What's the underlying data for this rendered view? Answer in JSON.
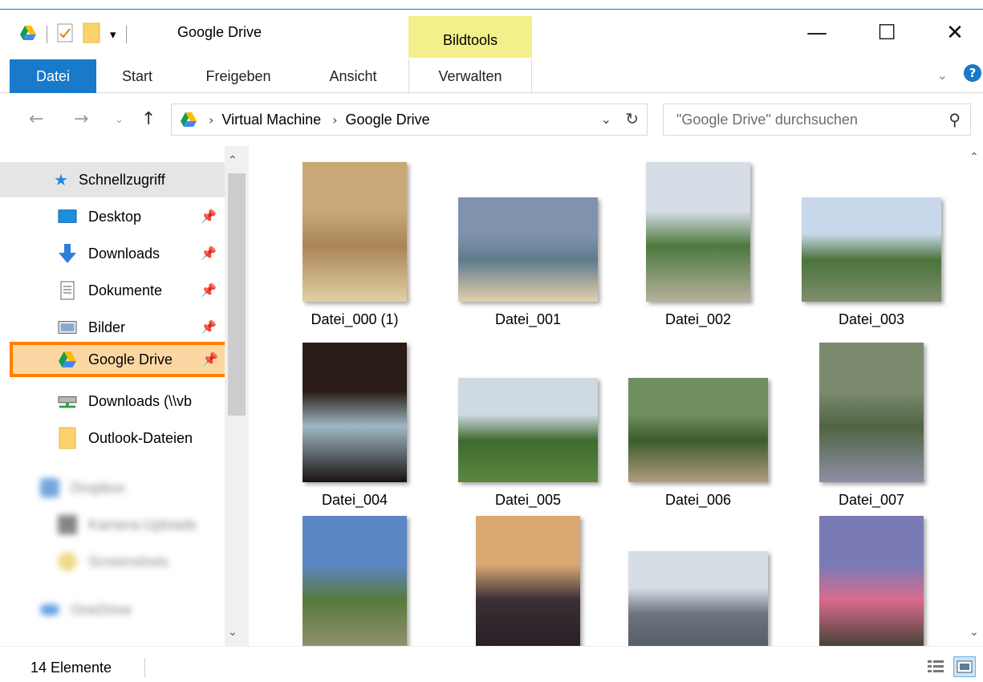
{
  "window": {
    "title": "Google Drive",
    "contextual_tab_group": "Bildtools",
    "controls": {
      "minimize": "—",
      "maximize": "☐",
      "close": "✕"
    }
  },
  "ribbon": {
    "tabs": [
      "Datei",
      "Start",
      "Freigeben",
      "Ansicht",
      "Verwalten"
    ],
    "active_tab": "Datei",
    "help": "?"
  },
  "address": {
    "crumbs": [
      "Virtual Machine",
      "Google Drive"
    ],
    "search_placeholder": "\"Google Drive\" durchsuchen"
  },
  "sidebar": {
    "quick_access": "Schnellzugriff",
    "items": [
      {
        "label": "Desktop",
        "icon": "desktop-icon",
        "pinned": true
      },
      {
        "label": "Downloads",
        "icon": "download-arrow-icon",
        "pinned": true
      },
      {
        "label": "Dokumente",
        "icon": "document-icon",
        "pinned": true
      },
      {
        "label": "Bilder",
        "icon": "pictures-icon",
        "pinned": true
      },
      {
        "label": "Google Drive",
        "icon": "google-drive-icon",
        "pinned": true,
        "highlighted": true
      },
      {
        "label": "Downloads (\\\\vb",
        "icon": "network-drive-icon",
        "pinned": false
      },
      {
        "label": "Outlook-Dateien",
        "icon": "folder-icon",
        "pinned": false
      }
    ],
    "blurred": [
      "Dropbox",
      "Kamera-Uploads",
      "Screenshots",
      "OneDrive"
    ]
  },
  "files": [
    {
      "name": "Datei_000 (1)",
      "orientation": "portrait",
      "palette": [
        "#c9a878",
        "#a98556",
        "#e2cfa6"
      ]
    },
    {
      "name": "Datei_001",
      "orientation": "landscape",
      "palette": [
        "#7f93ad",
        "#5e7c8c",
        "#e4d0ab"
      ]
    },
    {
      "name": "Datei_002",
      "orientation": "portrait",
      "palette": [
        "#d6dde6",
        "#4d7a3f",
        "#b6b09c"
      ]
    },
    {
      "name": "Datei_003",
      "orientation": "landscape",
      "palette": [
        "#c8d8ea",
        "#4b7339",
        "#7e8f6c"
      ]
    },
    {
      "name": "Datei_004",
      "orientation": "portrait",
      "palette": [
        "#2a1d18",
        "#9fb9c5",
        "#1a1210"
      ]
    },
    {
      "name": "Datei_005",
      "orientation": "landscape",
      "palette": [
        "#cfd9e4",
        "#3f6a2e",
        "#5b8642"
      ]
    },
    {
      "name": "Datei_006",
      "orientation": "landscape",
      "palette": [
        "#6f8f5e",
        "#3b5c2c",
        "#b39c7e"
      ]
    },
    {
      "name": "Datei_007",
      "orientation": "portrait",
      "palette": [
        "#7b8a6e",
        "#506443",
        "#8f8fa3"
      ]
    },
    {
      "name": "",
      "orientation": "portrait",
      "palette": [
        "#5d86c6",
        "#577a3b",
        "#9c9476"
      ]
    },
    {
      "name": "",
      "orientation": "portrait",
      "palette": [
        "#d9a873",
        "#3a3036",
        "#241d22"
      ]
    },
    {
      "name": "",
      "orientation": "landscape",
      "palette": [
        "#d7dde4",
        "#6d7480",
        "#50575f"
      ]
    },
    {
      "name": "",
      "orientation": "portrait",
      "palette": [
        "#7a7bb6",
        "#d96b8e",
        "#2b3a25"
      ]
    }
  ],
  "status": {
    "count": "14 Elemente"
  },
  "colors": {
    "accent": "#1979ca",
    "highlight": "#fcd7a4",
    "highlight_border": "#ff7f00",
    "contextual": "#f2f08a"
  }
}
